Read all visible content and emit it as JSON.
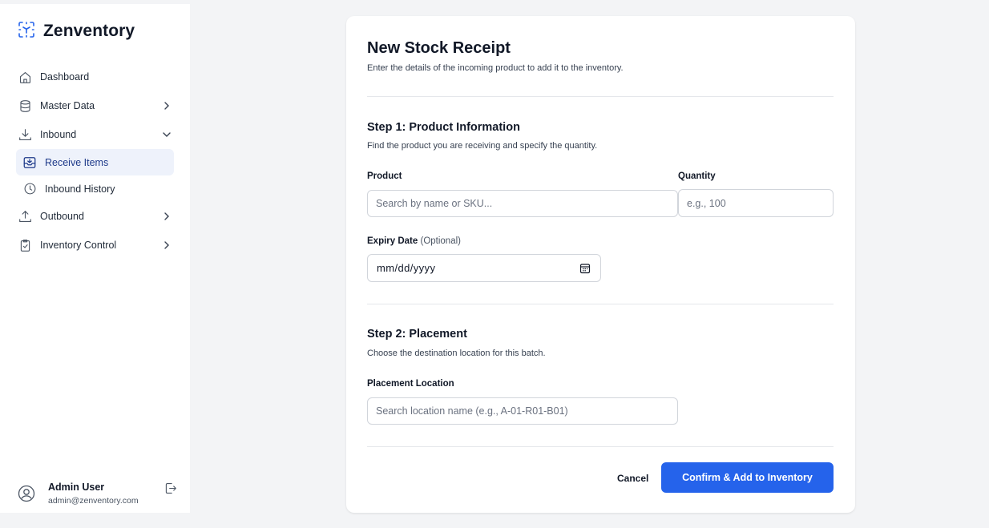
{
  "app": {
    "title": "Zenventory",
    "logo_icon": "cube-scan-icon"
  },
  "sidebar": {
    "items": [
      {
        "label": "Dashboard",
        "icon": "home-icon"
      },
      {
        "label": "Master Data",
        "icon": "database-icon",
        "expanded": false
      },
      {
        "label": "Inbound",
        "icon": "download-icon",
        "expanded": true
      },
      {
        "label": "Outbound",
        "icon": "upload-icon",
        "expanded": false
      },
      {
        "label": "Inventory Control",
        "icon": "clipboard-check-icon",
        "expanded": false
      }
    ],
    "inbound_children": [
      {
        "label": "Receive Items",
        "icon": "inbox-download-icon",
        "active": true
      },
      {
        "label": "Inbound History",
        "icon": "clock-icon",
        "active": false
      }
    ]
  },
  "user": {
    "name": "Admin User",
    "email": "admin@zenventory.com",
    "logout_icon": "logout-icon"
  },
  "form": {
    "title": "New Stock Receipt",
    "subtitle": "Enter the details of the incoming product to add it to the inventory.",
    "step1": {
      "title": "Step 1: Product Information",
      "subtitle": "Find the product you are receiving and specify the quantity.",
      "product_label": "Product",
      "product_placeholder": "Search by name or SKU...",
      "quantity_label": "Quantity",
      "quantity_placeholder": "e.g., 100",
      "expiry_label": "Expiry Date",
      "expiry_optional": "(Optional)",
      "expiry_value": "mm/dd/yyyy"
    },
    "step2": {
      "title": "Step 2: Placement",
      "subtitle": "Choose the destination location for this batch.",
      "location_label": "Placement Location",
      "location_placeholder": "Search location name (e.g., A-01-R01-B01)"
    },
    "cancel_label": "Cancel",
    "confirm_label": "Confirm & Add to Inventory"
  },
  "colors": {
    "accent": "#2563eb",
    "brand_icon": "#2563eb",
    "active_bg": "#eef2fb",
    "page_bg": "#f3f4f6"
  }
}
